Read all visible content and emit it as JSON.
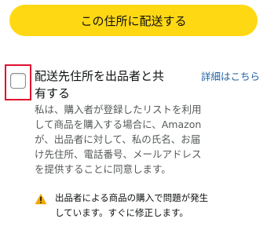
{
  "address_button": {
    "label": "この住所に配送する"
  },
  "share_option": {
    "checked": false,
    "title": "配送先住所を出品者と共有する",
    "details_link": "詳細はこちら",
    "description": "私は、購入者が登録したリストを利用して商品を購入する場合に、Amazonが、出品者に対して、私の氏名、お届け先住所、電話番号、メールアドレスを提供することに同意します。"
  },
  "warning": {
    "icon": "warning-icon",
    "color": "#f0a800",
    "text": "出品者による商品の購入で問題が発生しています。すぐに修正します。"
  },
  "colors": {
    "button": "#ffd814",
    "link": "#2162a1",
    "highlight_border": "#e0102f"
  }
}
